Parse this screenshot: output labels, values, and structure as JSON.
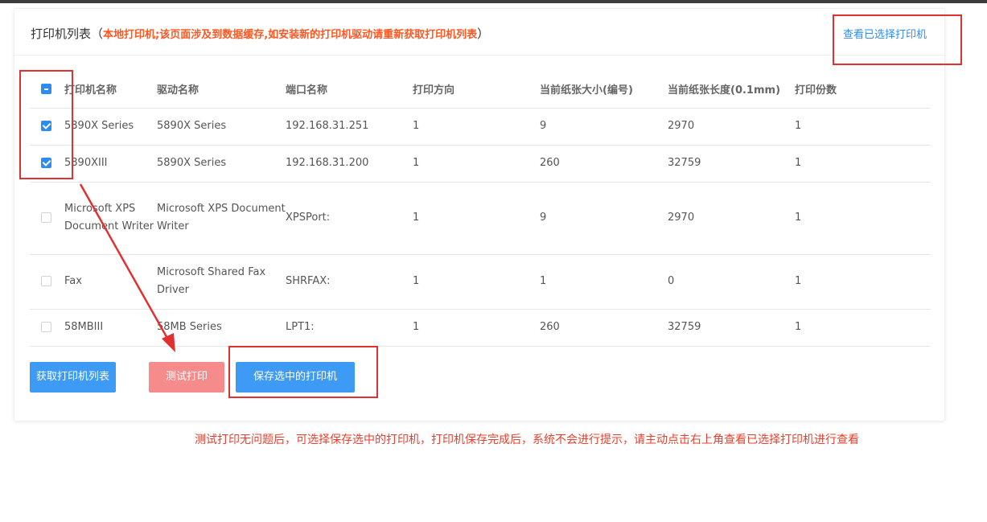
{
  "header": {
    "title": "打印机列表",
    "paren_open": "（",
    "warning": "本地打印机;该页面涉及到数据缓存,如安装新的打印机驱动请重新获取打印机列表",
    "paren_close": "）",
    "view_selected_link": "查看已选择打印机"
  },
  "table": {
    "columns": [
      "打印机名称",
      "驱动名称",
      "端口名称",
      "打印方向",
      "当前纸张大小(编号)",
      "当前纸张长度(0.1mm)",
      "打印份数"
    ],
    "header_checkbox_state": "partial",
    "rows": [
      {
        "checked": true,
        "name": "5890X Series",
        "driver": "5890X Series",
        "port": "192.168.31.251",
        "direction": "1",
        "paper_size": "9",
        "paper_length": "2970",
        "copies": "1"
      },
      {
        "checked": true,
        "name": "5890XIII",
        "driver": "5890X Series",
        "port": "192.168.31.200",
        "direction": "1",
        "paper_size": "260",
        "paper_length": "32759",
        "copies": "1"
      },
      {
        "checked": false,
        "name": "Microsoft XPS Document Writer",
        "driver": "Microsoft XPS Document Writer",
        "port": "XPSPort:",
        "direction": "1",
        "paper_size": "9",
        "paper_length": "2970",
        "copies": "1"
      },
      {
        "checked": false,
        "name": "Fax",
        "driver": "Microsoft Shared Fax Driver",
        "port": "SHRFAX:",
        "direction": "1",
        "paper_size": "1",
        "paper_length": "0",
        "copies": "1"
      },
      {
        "checked": false,
        "name": "58MBIII",
        "driver": "58MB Series",
        "port": "LPT1:",
        "direction": "1",
        "paper_size": "260",
        "paper_length": "32759",
        "copies": "1"
      }
    ]
  },
  "buttons": {
    "fetch": "获取打印机列表",
    "test": "测试打印",
    "save": "保存选中的打印机"
  },
  "hint": "测试打印无问题后，可选择保存选中的打印机，打印机保存完成后，系统不会进行提示，请主动点击右上角查看已选择打印机进行查看",
  "colors": {
    "primary": "#3d9bf6",
    "test_button": "#f68b8b",
    "warning_text": "#ff5722",
    "annotation_red": "#e03131",
    "link": "#2d8cf0"
  }
}
